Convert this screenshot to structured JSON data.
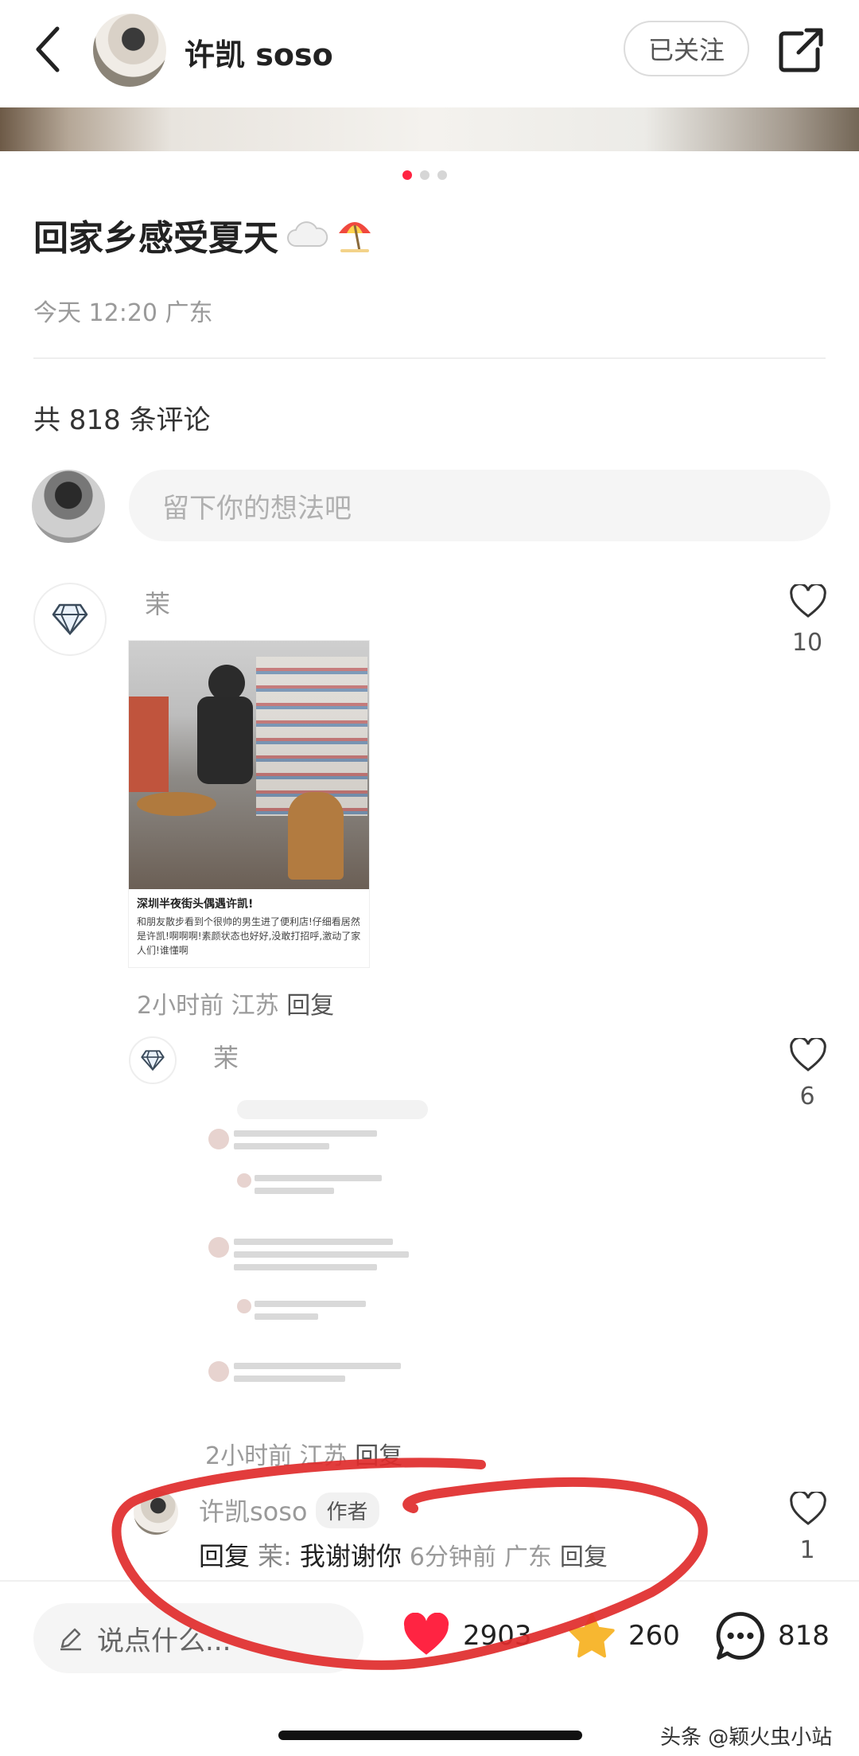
{
  "header": {
    "author_name": "许凯 soso",
    "follow_label": "已关注"
  },
  "post": {
    "title": "回家乡感受夏天",
    "title_emoji": "☁️🏖",
    "meta": "今天 12:20 广东",
    "comment_count_label": "共 818 条评论"
  },
  "comment_box": {
    "placeholder": "留下你的想法吧"
  },
  "comments": [
    {
      "user": "茉",
      "likes": "10",
      "image_caption_title": "深圳半夜街头偶遇许凯!",
      "image_caption_body": "和朋友散步看到个很帅的男生进了便利店!仔细看居然是许凯!啊啊啊!素颜状态也好好,没敢打招呼,激动了家人们!谁懂啊",
      "time": "2小时前",
      "location": "江苏",
      "reply_label": "回复"
    },
    {
      "user": "茉",
      "likes": "6",
      "time": "2小时前",
      "location": "江苏",
      "reply_label": "回复"
    },
    {
      "user": "许凯soso",
      "author_tag": "作者",
      "likes": "1",
      "reply_prefix": "回复",
      "reply_to": "茉:",
      "text": "我谢谢你",
      "time": "6分钟前",
      "location": "广东",
      "reply_label": "回复"
    }
  ],
  "bottom_bar": {
    "input_label": "说点什么...",
    "likes": "2903",
    "stars": "260",
    "comments": "818"
  },
  "watermark": "头条 @颖火虫小站",
  "colors": {
    "accent": "#ff2442",
    "star": "#f7b731",
    "annotation_red": "#e02b2b"
  }
}
